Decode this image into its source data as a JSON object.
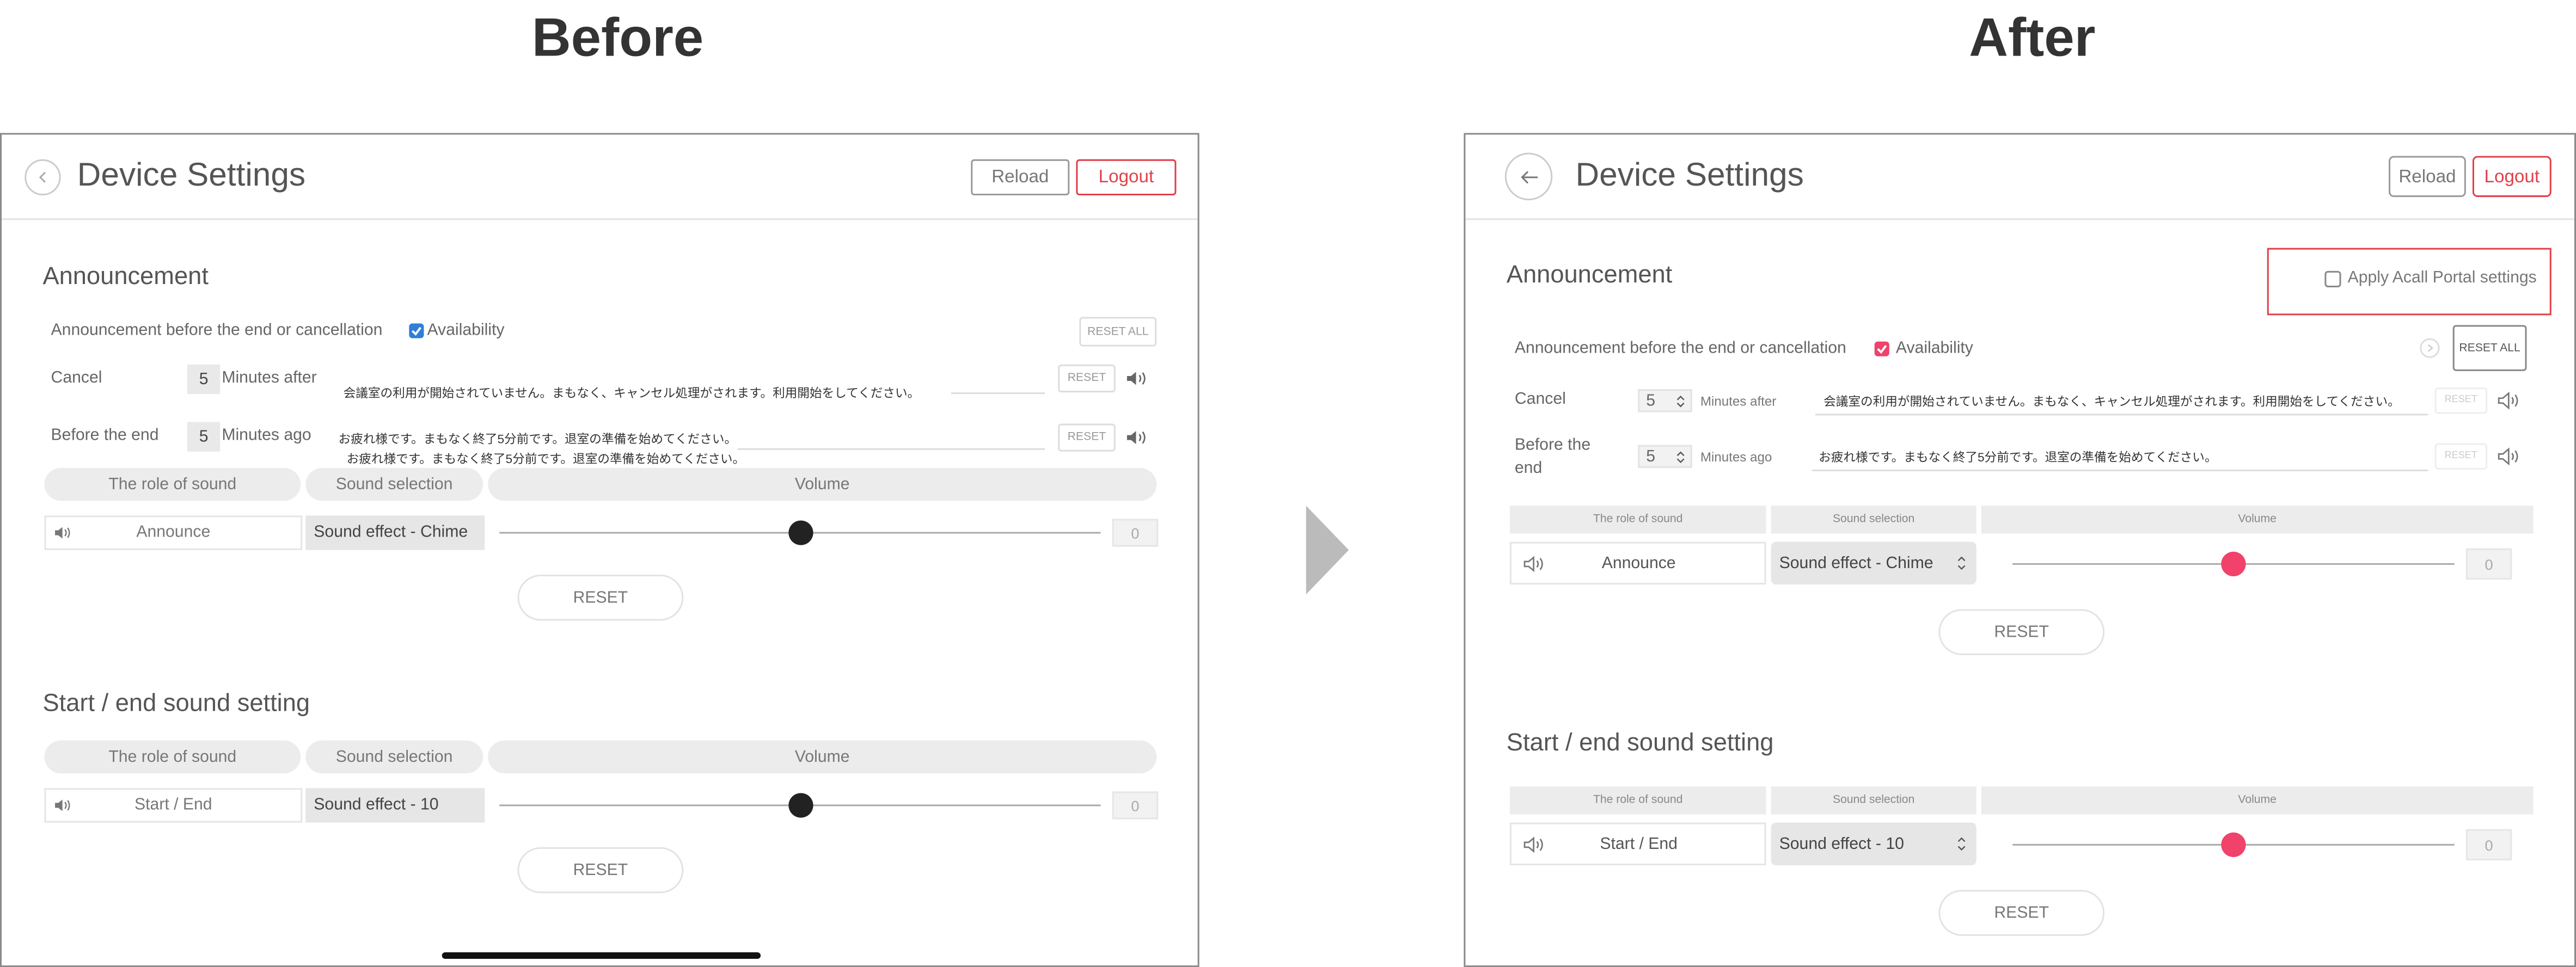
{
  "labels": {
    "before": "Before",
    "after": "After"
  },
  "colors": {
    "accent_red": "#e0404a",
    "thumb_pink": "#f0426a",
    "thumb_dark": "#222222",
    "check_blue": "#2f7fd8"
  },
  "before": {
    "header": {
      "title": "Device Settings",
      "reload": "Reload",
      "logout": "Logout"
    },
    "announcement": {
      "title": "Announcement",
      "row_label": "Announcement before the end or cancellation",
      "availability": "Availability",
      "reset_all": "RESET ALL",
      "cancel": {
        "label": "Cancel",
        "value": "5",
        "unit": "Minutes after",
        "message": "会議室の利用が開始されていません。まもなく、キャンセル処理がされます。利用開始をしてください。",
        "reset": "RESET"
      },
      "before_end": {
        "label": "Before the end",
        "value": "5",
        "unit": "Minutes ago",
        "message": "お疲れ様です。まもなく終了5分前です。退室の準備を始めてください。",
        "reset": "RESET"
      },
      "table": {
        "col_role": "The role of sound",
        "col_selection": "Sound selection",
        "col_volume": "Volume",
        "role": "Announce",
        "selection": "Sound effect - Chime",
        "volume_fraction": 0.5,
        "volume_value": "0"
      },
      "reset": "RESET"
    },
    "start_end": {
      "title": "Start / end sound setting",
      "table": {
        "col_role": "The role of sound",
        "col_selection": "Sound selection",
        "col_volume": "Volume",
        "role": "Start / End",
        "selection": "Sound effect - 10",
        "volume_fraction": 0.5,
        "volume_value": "0"
      },
      "reset": "RESET"
    }
  },
  "after": {
    "header": {
      "title": "Device Settings",
      "reload": "Reload",
      "logout": "Logout"
    },
    "announcement": {
      "title": "Announcement",
      "apply_portal": "Apply Acall Portal settings",
      "row_label": "Announcement before the end or cancellation",
      "availability": "Availability",
      "reset_all": "RESET ALL",
      "cancel": {
        "label": "Cancel",
        "value": "5",
        "unit": "Minutes after",
        "message": "会議室の利用が開始されていません。まもなく、キャンセル処理がされます。利用開始をしてください。",
        "reset": "RESET"
      },
      "before_end": {
        "label": "Before the end",
        "value": "5",
        "unit": "Minutes ago",
        "message": "お疲れ様です。まもなく終了5分前です。退室の準備を始めてください。",
        "reset": "RESET"
      },
      "table": {
        "col_role": "The role of sound",
        "col_selection": "Sound selection",
        "col_volume": "Volume",
        "role": "Announce",
        "selection": "Sound effect - Chime",
        "volume_fraction": 0.5,
        "volume_value": "0"
      },
      "reset": "RESET"
    },
    "start_end": {
      "title": "Start / end sound setting",
      "table": {
        "col_role": "The role of sound",
        "col_selection": "Sound selection",
        "col_volume": "Volume",
        "role": "Start / End",
        "selection": "Sound effect - 10",
        "volume_fraction": 0.5,
        "volume_value": "0"
      },
      "reset": "RESET"
    }
  }
}
